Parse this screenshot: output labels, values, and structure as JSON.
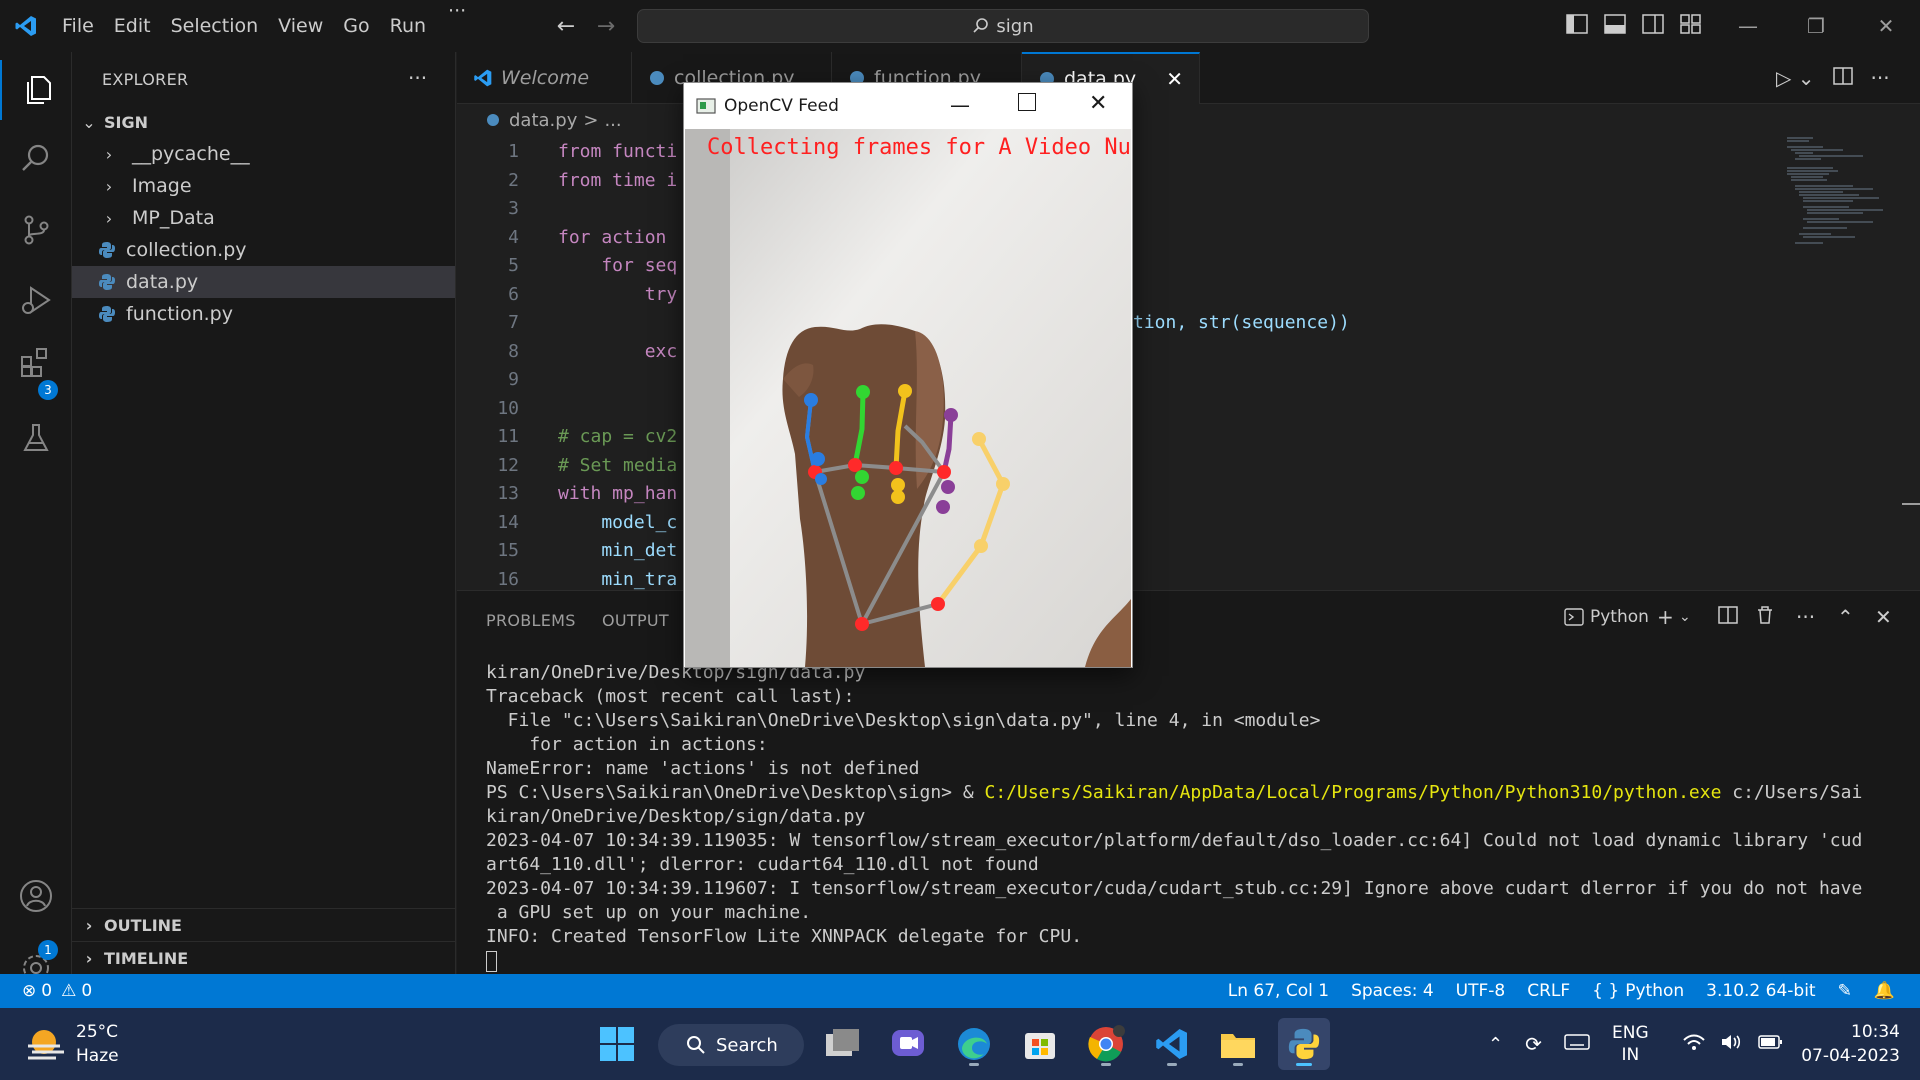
{
  "menu": {
    "items": [
      "File",
      "Edit",
      "Selection",
      "View",
      "Go",
      "Run"
    ],
    "more": "···"
  },
  "command_center": {
    "text": "sign"
  },
  "explorer": {
    "title": "EXPLORER",
    "more": "···",
    "folder": "SIGN",
    "items": [
      {
        "label": "__pycache__",
        "type": "folder"
      },
      {
        "label": "Image",
        "type": "folder"
      },
      {
        "label": "MP_Data",
        "type": "folder"
      },
      {
        "label": "collection.py",
        "type": "file"
      },
      {
        "label": "data.py",
        "type": "file",
        "selected": true
      },
      {
        "label": "function.py",
        "type": "file"
      }
    ],
    "outline": "OUTLINE",
    "timeline": "TIMELINE"
  },
  "activity_badges": {
    "extensions": "3",
    "settings": "1"
  },
  "tabs": [
    {
      "label": "Welcome",
      "icon": "vscode-icon"
    },
    {
      "label": "collection.py",
      "icon": "python-icon"
    },
    {
      "label": "function.py",
      "icon": "python-icon"
    },
    {
      "label": "data.py",
      "icon": "python-icon",
      "active": true
    }
  ],
  "breadcrumb": {
    "file": "data.py",
    "sep": ">",
    "rest": "..."
  },
  "code_lines": [
    {
      "n": "1",
      "text": "from functi"
    },
    {
      "n": "2",
      "text": "from time i"
    },
    {
      "n": "3",
      "text": ""
    },
    {
      "n": "4",
      "text": "for action "
    },
    {
      "n": "5",
      "text": "    for seq"
    },
    {
      "n": "6",
      "text": "        try"
    },
    {
      "n": "7",
      "text": "tion, str(sequence))"
    },
    {
      "n": "8",
      "text": "        exc"
    },
    {
      "n": "9",
      "text": ""
    },
    {
      "n": "10",
      "text": ""
    },
    {
      "n": "11",
      "text": "# cap = cv2"
    },
    {
      "n": "12",
      "text": "# Set media"
    },
    {
      "n": "13",
      "text": "with mp_han"
    },
    {
      "n": "14",
      "text": "    model_c"
    },
    {
      "n": "15",
      "text": "    min_det"
    },
    {
      "n": "16",
      "text": "    min_tra"
    }
  ],
  "panel": {
    "tabs": [
      "PROBLEMS",
      "OUTPUT"
    ],
    "terminal_profile": "Python",
    "terminal_lines": [
      "kiran/OneDrive/Desktop/sign/data.py",
      "Traceback (most recent call last):",
      "  File \"c:\\Users\\Saikiran\\OneDrive\\Desktop\\sign\\data.py\", line 4, in <module>",
      "    for action in actions:",
      "NameError: name 'actions' is not defined",
      "kiran/OneDrive/Desktop/sign/data.py",
      "2023-04-07 10:34:39.119035: W tensorflow/stream_executor/platform/default/dso_loader.cc:64] Could not load dynamic library 'cud",
      "art64_110.dll'; dlerror: cudart64_110.dll not found",
      "2023-04-07 10:34:39.119607: I tensorflow/stream_executor/cuda/cudart_stub.cc:29] Ignore above cudart dlerror if you do not have",
      " a GPU set up on your machine.",
      "INFO: Created TensorFlow Lite XNNPACK delegate for CPU."
    ],
    "ps_prompt": "PS C:\\Users\\Saikiran\\OneDrive\\Desktop\\sign> & ",
    "ps_exe": "C:/Users/Saikiran/AppData/Local/Programs/Python/Python310/python.exe",
    "ps_arg": " c:/Users/Sai"
  },
  "cv_window": {
    "title": "OpenCV Feed",
    "overlay_text": "Collecting frames for A Video Numb"
  },
  "statusbar": {
    "errors": "0",
    "warnings": "0",
    "position": "Ln 67, Col 1",
    "spaces": "Spaces: 4",
    "encoding": "UTF-8",
    "eol": "CRLF",
    "language": "Python",
    "interpreter": "3.10.2 64-bit"
  },
  "taskbar": {
    "weather_temp": "25°C",
    "weather_desc": "Haze",
    "search": "Search",
    "lang_top": "ENG",
    "lang_bottom": "IN",
    "time": "10:34",
    "date": "07-04-2023"
  },
  "colors": {
    "accent": "#0078d4",
    "statusbar": "#0078d4",
    "taskbar": "#1c2b4a",
    "cv_overlay": "#ff2020"
  }
}
